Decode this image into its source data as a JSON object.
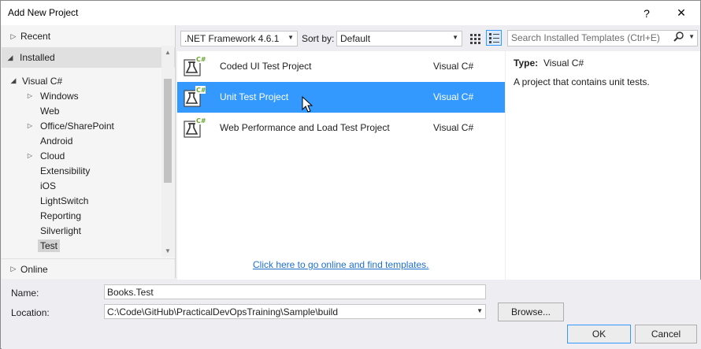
{
  "window": {
    "title": "Add New Project",
    "help_label": "?",
    "close_label": "✕"
  },
  "left_pane": {
    "sections": {
      "recent": "Recent",
      "installed": "Installed",
      "online": "Online"
    },
    "root": "Visual C#",
    "items": [
      {
        "label": "Windows",
        "expandable": true
      },
      {
        "label": "Web",
        "expandable": false
      },
      {
        "label": "Office/SharePoint",
        "expandable": true
      },
      {
        "label": "Android",
        "expandable": false
      },
      {
        "label": "Cloud",
        "expandable": true
      },
      {
        "label": "Extensibility",
        "expandable": false
      },
      {
        "label": "iOS",
        "expandable": false
      },
      {
        "label": "LightSwitch",
        "expandable": false
      },
      {
        "label": "Reporting",
        "expandable": false
      },
      {
        "label": "Silverlight",
        "expandable": false
      },
      {
        "label": "Test",
        "expandable": false,
        "selected": true
      }
    ]
  },
  "toolbar": {
    "framework": ".NET Framework 4.6.1",
    "sort_label": "Sort by:",
    "sort_value": "Default",
    "search_placeholder": "Search Installed Templates (Ctrl+E)"
  },
  "templates": [
    {
      "name": "Coded UI Test Project",
      "language": "Visual C#",
      "selected": false
    },
    {
      "name": "Unit Test Project",
      "language": "Visual C#",
      "selected": true
    },
    {
      "name": "Web Performance and Load Test Project",
      "language": "Visual C#",
      "selected": false
    }
  ],
  "online_link": "Click here to go online and find templates.",
  "details": {
    "type_label": "Type:",
    "type_value": "Visual C#",
    "description": "A project that contains unit tests."
  },
  "form": {
    "name_label": "Name:",
    "name_value": "Books.Test",
    "location_label": "Location:",
    "location_value": "C:\\Code\\GitHub\\PracticalDevOpsTraining\\Sample\\build",
    "browse_label": "Browse...",
    "ok_label": "OK",
    "cancel_label": "Cancel"
  },
  "colors": {
    "selection": "#3399ff",
    "link": "#1e70cd",
    "icon_badge": "#68a42e"
  }
}
